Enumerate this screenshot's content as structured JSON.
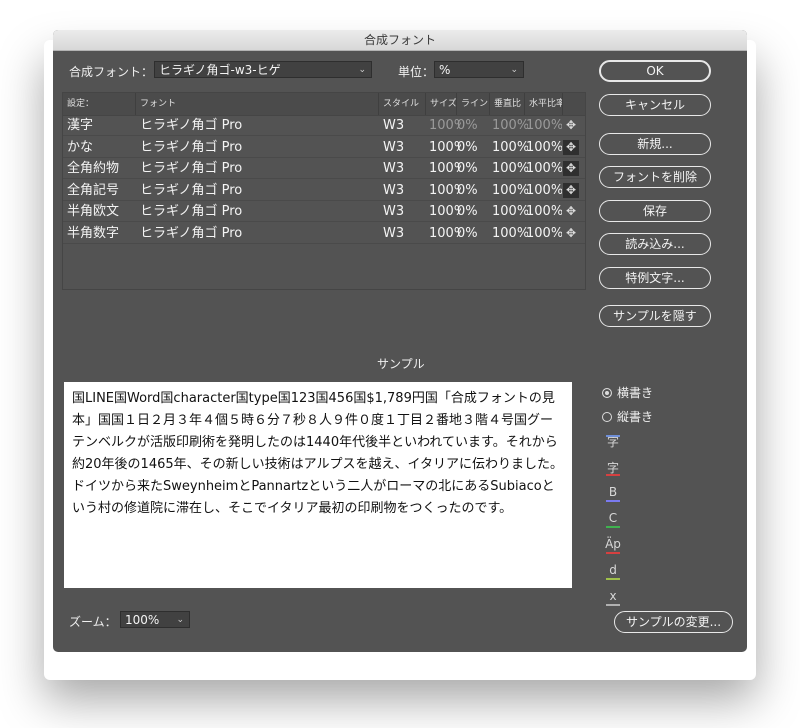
{
  "window": {
    "title": "合成フォント"
  },
  "header": {
    "font_label": "合成フォント：",
    "font_value": "ヒラギノ角ゴ-w3-ヒゲ",
    "unit_label": "単位：",
    "unit_value": "%"
  },
  "table": {
    "columns": [
      "設定：",
      "フォント",
      "スタイル",
      "サイズ",
      "ライン",
      "垂直比",
      "水平比率"
    ],
    "rows": [
      {
        "setting": "漢字",
        "font": "ヒラギノ角ゴ Pro",
        "style": "W3",
        "size": "100%",
        "line": "0%",
        "vert": "100%",
        "horiz": "100%",
        "dim": true
      },
      {
        "setting": "かな",
        "font": "ヒラギノ角ゴ Pro",
        "style": "W3",
        "size": "100%",
        "line": "0%",
        "vert": "100%",
        "horiz": "100%",
        "dim": false
      },
      {
        "setting": "全角約物",
        "font": "ヒラギノ角ゴ Pro",
        "style": "W3",
        "size": "100%",
        "line": "0%",
        "vert": "100%",
        "horiz": "100%",
        "dim": false
      },
      {
        "setting": "全角記号",
        "font": "ヒラギノ角ゴ Pro",
        "style": "W3",
        "size": "100%",
        "line": "0%",
        "vert": "100%",
        "horiz": "100%",
        "dim": false
      },
      {
        "setting": "半角欧文",
        "font": "ヒラギノ角ゴ Pro",
        "style": "W3",
        "size": "100%",
        "line": "0%",
        "vert": "100%",
        "horiz": "100%",
        "dim": false
      },
      {
        "setting": "半角数字",
        "font": "ヒラギノ角ゴ Pro",
        "style": "W3",
        "size": "100%",
        "line": "0%",
        "vert": "100%",
        "horiz": "100%",
        "dim": false
      }
    ]
  },
  "buttons": {
    "ok": "OK",
    "cancel": "キャンセル",
    "new": "新規...",
    "delete_font": "フォントを削除",
    "save": "保存",
    "load": "読み込み...",
    "exceptions": "特例文字...",
    "hide_sample": "サンプルを隠す",
    "change_sample": "サンプルの変更..."
  },
  "sample": {
    "label": "サンプル",
    "text": "国LINE国Word国character国type国123国456国$1,789円国「合成フォントの見本」国国１日２月３年４個５時６分７秒８人９件０度１丁目２番地３階４号国グーテンベルクが活版印刷術を発明したのは1440年代後半といわれています。それから約20年後の1465年、その新しい技術はアルプスを越え、イタリアに伝わりました。ドイツから来たSweynheimとPannartzという二人がローマの北にあるSubiacoという村の修道院に滞在し、そこでイタリア最初の印刷物をつくったのです。"
  },
  "orientation": {
    "horizontal": "横書き",
    "vertical": "縦書き",
    "selected": "horizontal"
  },
  "guides": [
    {
      "glyph": "字",
      "color": "#6f8fd8"
    },
    {
      "glyph": "字",
      "color": "#d64040"
    },
    {
      "glyph": "B",
      "color": "#7a7af0"
    },
    {
      "glyph": "C",
      "color": "#3fb24f"
    },
    {
      "glyph": "Äp",
      "color": "#d64040"
    },
    {
      "glyph": "d",
      "color": "#9fc04a"
    },
    {
      "glyph": "x",
      "color": "#b0b0b0"
    }
  ],
  "zoom": {
    "label": "ズーム：",
    "value": "100%"
  }
}
